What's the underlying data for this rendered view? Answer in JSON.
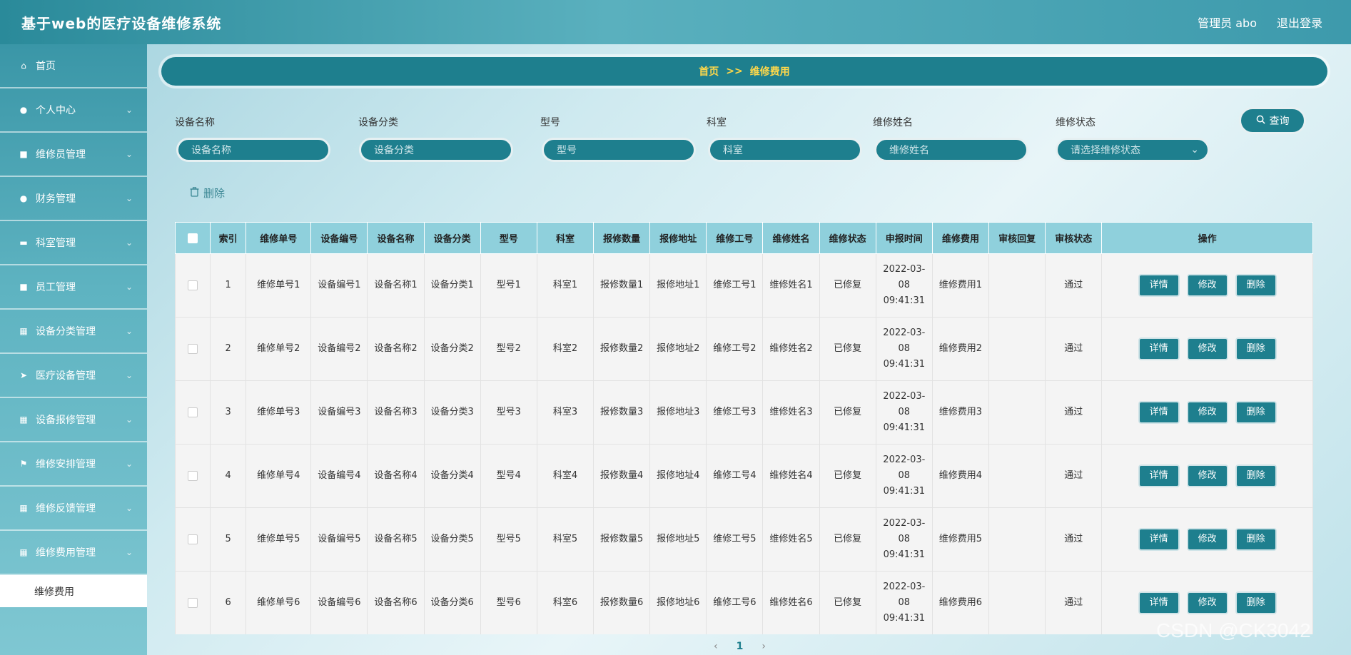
{
  "header": {
    "title": "基于web的医疗设备维修系统",
    "user": "管理员 abo",
    "logout": "退出登录"
  },
  "sidebar": {
    "items": [
      {
        "label": "首页",
        "icon": "home-icon",
        "glyph": "⌂",
        "chevron": false
      },
      {
        "label": "个人中心",
        "icon": "user-icon",
        "glyph": "●",
        "chevron": true
      },
      {
        "label": "维修员管理",
        "icon": "edit-icon",
        "glyph": "■",
        "chevron": true
      },
      {
        "label": "财务管理",
        "icon": "person-icon",
        "glyph": "●",
        "chevron": true
      },
      {
        "label": "科室管理",
        "icon": "ticket-icon",
        "glyph": "▬",
        "chevron": true
      },
      {
        "label": "员工管理",
        "icon": "printer-icon",
        "glyph": "■",
        "chevron": true
      },
      {
        "label": "设备分类管理",
        "icon": "grid-icon",
        "glyph": "▦",
        "chevron": true
      },
      {
        "label": "医疗设备管理",
        "icon": "send-icon",
        "glyph": "➤",
        "chevron": true
      },
      {
        "label": "设备报修管理",
        "icon": "grid-icon",
        "glyph": "▦",
        "chevron": true
      },
      {
        "label": "维修安排管理",
        "icon": "flag-icon",
        "glyph": "⚑",
        "chevron": true
      },
      {
        "label": "维修反馈管理",
        "icon": "grid-icon",
        "glyph": "▦",
        "chevron": true
      },
      {
        "label": "维修费用管理",
        "icon": "apps-icon",
        "glyph": "▦",
        "chevron": true
      }
    ],
    "sub_item": "维修费用"
  },
  "breadcrumb": {
    "home": "首页",
    "sep": ">>",
    "current": "维修费用"
  },
  "search": {
    "fields": [
      {
        "label": "设备名称",
        "placeholder": "设备名称"
      },
      {
        "label": "设备分类",
        "placeholder": "设备分类"
      },
      {
        "label": "型号",
        "placeholder": "型号"
      },
      {
        "label": "科室",
        "placeholder": "科室"
      },
      {
        "label": "维修姓名",
        "placeholder": "维修姓名"
      },
      {
        "label": "维修状态",
        "placeholder": "请选择维修状态"
      }
    ],
    "query_label": "查询",
    "delete_label": "删除"
  },
  "table": {
    "columns": [
      "索引",
      "维修单号",
      "设备编号",
      "设备名称",
      "设备分类",
      "型号",
      "科室",
      "报修数量",
      "报修地址",
      "维修工号",
      "维修姓名",
      "维修状态",
      "申报时间",
      "维修费用",
      "审核回复",
      "审核状态",
      "操作"
    ],
    "rows": [
      {
        "idx": "1",
        "order": "维修单号1",
        "code": "设备编号1",
        "name": "设备名称1",
        "cat": "设备分类1",
        "model": "型号1",
        "dept": "科室1",
        "qty": "报修数量1",
        "addr": "报修地址1",
        "wno": "维修工号1",
        "wname": "维修姓名1",
        "status": "已修复",
        "time": "2022-03-08 09:41:31",
        "fee": "维修费用1",
        "reply": "",
        "audit": "通过"
      },
      {
        "idx": "2",
        "order": "维修单号2",
        "code": "设备编号2",
        "name": "设备名称2",
        "cat": "设备分类2",
        "model": "型号2",
        "dept": "科室2",
        "qty": "报修数量2",
        "addr": "报修地址2",
        "wno": "维修工号2",
        "wname": "维修姓名2",
        "status": "已修复",
        "time": "2022-03-08 09:41:31",
        "fee": "维修费用2",
        "reply": "",
        "audit": "通过"
      },
      {
        "idx": "3",
        "order": "维修单号3",
        "code": "设备编号3",
        "name": "设备名称3",
        "cat": "设备分类3",
        "model": "型号3",
        "dept": "科室3",
        "qty": "报修数量3",
        "addr": "报修地址3",
        "wno": "维修工号3",
        "wname": "维修姓名3",
        "status": "已修复",
        "time": "2022-03-08 09:41:31",
        "fee": "维修费用3",
        "reply": "",
        "audit": "通过"
      },
      {
        "idx": "4",
        "order": "维修单号4",
        "code": "设备编号4",
        "name": "设备名称4",
        "cat": "设备分类4",
        "model": "型号4",
        "dept": "科室4",
        "qty": "报修数量4",
        "addr": "报修地址4",
        "wno": "维修工号4",
        "wname": "维修姓名4",
        "status": "已修复",
        "time": "2022-03-08 09:41:31",
        "fee": "维修费用4",
        "reply": "",
        "audit": "通过"
      },
      {
        "idx": "5",
        "order": "维修单号5",
        "code": "设备编号5",
        "name": "设备名称5",
        "cat": "设备分类5",
        "model": "型号5",
        "dept": "科室5",
        "qty": "报修数量5",
        "addr": "报修地址5",
        "wno": "维修工号5",
        "wname": "维修姓名5",
        "status": "已修复",
        "time": "2022-03-08 09:41:31",
        "fee": "维修费用5",
        "reply": "",
        "audit": "通过"
      },
      {
        "idx": "6",
        "order": "维修单号6",
        "code": "设备编号6",
        "name": "设备名称6",
        "cat": "设备分类6",
        "model": "型号6",
        "dept": "科室6",
        "qty": "报修数量6",
        "addr": "报修地址6",
        "wno": "维修工号6",
        "wname": "维修姓名6",
        "status": "已修复",
        "time": "2022-03-08 09:41:31",
        "fee": "维修费用6",
        "reply": "",
        "audit": "通过"
      }
    ],
    "actions": {
      "detail": "详情",
      "edit": "修改",
      "delete": "删除"
    }
  },
  "pager": {
    "prev": "‹",
    "page": "1",
    "next": "›"
  },
  "watermark": "CSDN @CK3042",
  "colors": {
    "primary": "#1e7f8e",
    "breadcrumb_text": "#ffd84a",
    "table_header": "#8fd0dc"
  }
}
